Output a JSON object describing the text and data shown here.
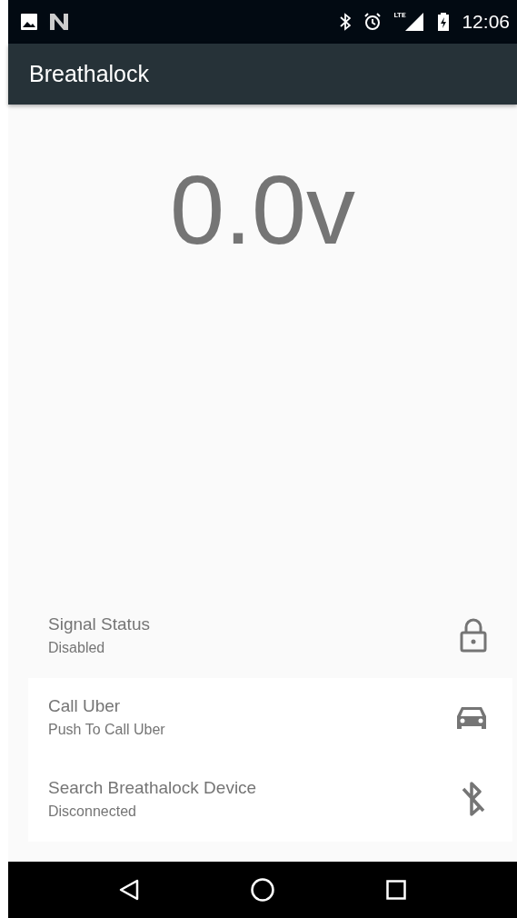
{
  "status_bar": {
    "network": "LTE",
    "time": "12:06"
  },
  "app_bar": {
    "title": "Breathalock"
  },
  "reading": "0.0v",
  "status_item": {
    "title": "Signal Status",
    "subtitle": "Disabled",
    "kind": "lock"
  },
  "actions": [
    {
      "title": "Call Uber",
      "subtitle": "Push To Call Uber",
      "kind": "car"
    },
    {
      "title": "Search Breathalock Device",
      "subtitle": "Disconnected",
      "kind": "bluetooth-off"
    }
  ]
}
